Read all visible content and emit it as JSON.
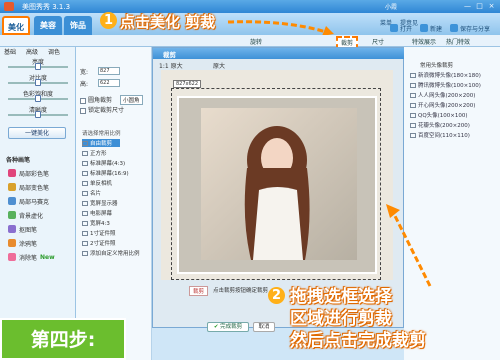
{
  "window": {
    "title": "美图秀秀 3.1.3",
    "user_label": "小霞",
    "controls": [
      "—",
      "□",
      "×"
    ]
  },
  "main_tabs": [
    {
      "label": "美化",
      "active": true
    },
    {
      "label": "美容",
      "active": false
    },
    {
      "label": "饰品",
      "active": false
    }
  ],
  "toolbar_right": {
    "open": "打开",
    "new": "新建",
    "save_share": "保存与分享",
    "menu1": "菜单",
    "menu2": "提意见"
  },
  "annotation_top": {
    "number": "1",
    "text": "点击美化 剪裁"
  },
  "subtool": {
    "rotate": "旋转",
    "crop": "裁剪",
    "resize": "尺寸",
    "effect_tabs": [
      "特效展示",
      "热门特效"
    ]
  },
  "left_tabs": [
    "基础",
    "高级",
    "调色"
  ],
  "sliders": [
    {
      "label": "亮度",
      "value": 0.5
    },
    {
      "label": "对比度",
      "value": 0.5
    },
    {
      "label": "色彩饱和度",
      "value": 0.5
    },
    {
      "label": "清晰度",
      "value": 0.5
    }
  ],
  "one_key_button": "一键美化",
  "pens": {
    "title": "各种画笔",
    "items": [
      "局部彩色笔",
      "局部变色笔",
      "局部马赛克",
      "背景虚化",
      "抠图笔",
      "涂鸦笔",
      "消除笔"
    ],
    "new_badge": "New"
  },
  "crop_panel": {
    "width_label": "宽:",
    "width_value": "827",
    "height_label": "高:",
    "height_value": "622",
    "rounded_crop": "圆角裁剪",
    "rounded_option": "小圆角",
    "lock_ratio": "锁定裁剪尺寸",
    "ratio_title": "请选择常用比例",
    "ratios": [
      "自由裁剪",
      "正方形",
      "标准屏幕(4:3)",
      "标准屏幕(16:9)",
      "单反相机",
      "名片",
      "宽屏显示器",
      "电影屏幕",
      "宽屏4:3",
      "1寸证件照",
      "2寸证件照",
      "添加自定义常用比例"
    ]
  },
  "crop_window": {
    "title": "裁剪",
    "original_label": "原大",
    "zoom_label": "1:1 原大",
    "size_tag": "827x622",
    "confirm_crop": "点击裁剪按钮确定裁剪",
    "crop_tag": "裁剪",
    "done_button": "完成裁剪",
    "cancel_button": "取消"
  },
  "right_panel": {
    "title": "常用头像裁剪",
    "items": [
      "新浪微博头像(180×180)",
      "腾讯微博头像(100×100)",
      "人人网头像(200×200)",
      "开心网头像(200×200)",
      "QQ头像(100×100)",
      "花瓣头像(200×200)",
      "百度空间(110×110)"
    ]
  },
  "annotation_bottom": {
    "number": "2",
    "line1": "拖拽选框选择",
    "line2": "区域进行剪裁",
    "line3": "然后点击完成裁剪"
  },
  "step_label": "第四步:",
  "colors": {
    "accent_orange": "#ffb018",
    "accent_blue": "#3d8fd6",
    "step_green": "#6bbe2e"
  }
}
